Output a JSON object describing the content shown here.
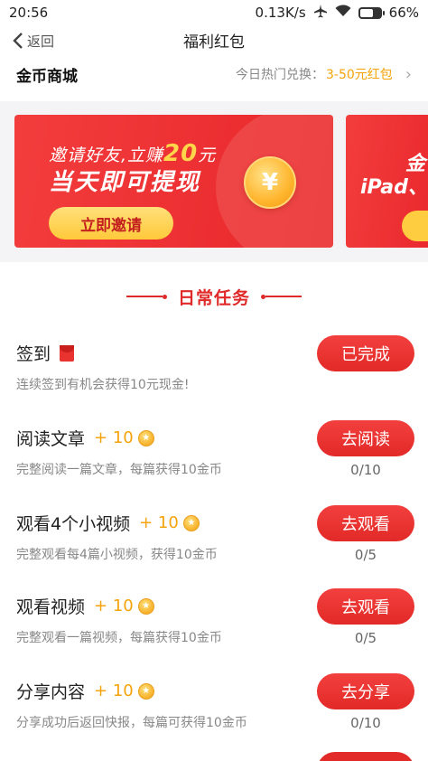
{
  "status_bar": {
    "time": "20:56",
    "network_speed": "0.13K/s",
    "battery": "66%",
    "battery_level": 0.66
  },
  "nav": {
    "back_label": "返回",
    "title": "福利红包"
  },
  "mall": {
    "title": "金币商城",
    "hot_label": "今日热门兑换：",
    "hot_value": "3-50元红包"
  },
  "banners": [
    {
      "line1_pre": "邀请好友,立赚",
      "line1_amount": "20",
      "line1_post": "元",
      "line2": "当天即可提现",
      "button": "立即邀请",
      "coin_symbol": "¥"
    },
    {
      "line1": "金",
      "line2": "iPad、"
    }
  ],
  "section": {
    "title": "日常任务"
  },
  "tasks": [
    {
      "name": "签到",
      "reward": "",
      "desc": "连续签到有机会获得10元现金!",
      "button": "已完成",
      "progress": ""
    },
    {
      "name": "阅读文章",
      "reward": "+ 10",
      "desc": "完整阅读一篇文章，每篇获得10金币",
      "button": "去阅读",
      "progress": "0/10"
    },
    {
      "name": "观看4个小视频",
      "reward": "+ 10",
      "desc": "完整观看每4篇小视频，获得10金币",
      "button": "去观看",
      "progress": "0/5"
    },
    {
      "name": "观看视频",
      "reward": "+ 10",
      "desc": "完整观看一篇视频，每篇获得10金币",
      "button": "去观看",
      "progress": "0/5"
    },
    {
      "name": "分享内容",
      "reward": "+ 10",
      "desc": "分享成功后返回快报，每篇可获得10金币",
      "button": "去分享",
      "progress": "0/10"
    }
  ],
  "icons": {
    "back": "chevron-left-icon",
    "airplane": "airplane-icon",
    "wifi": "wifi-icon",
    "battery": "battery-icon",
    "coin": "coin-icon",
    "envelope": "red-envelope-icon",
    "chevron": "chevron-right-icon"
  },
  "colors": {
    "accent_red": "#e22a28",
    "gold": "#f5a30a",
    "banner_button": "#ffc93a"
  }
}
